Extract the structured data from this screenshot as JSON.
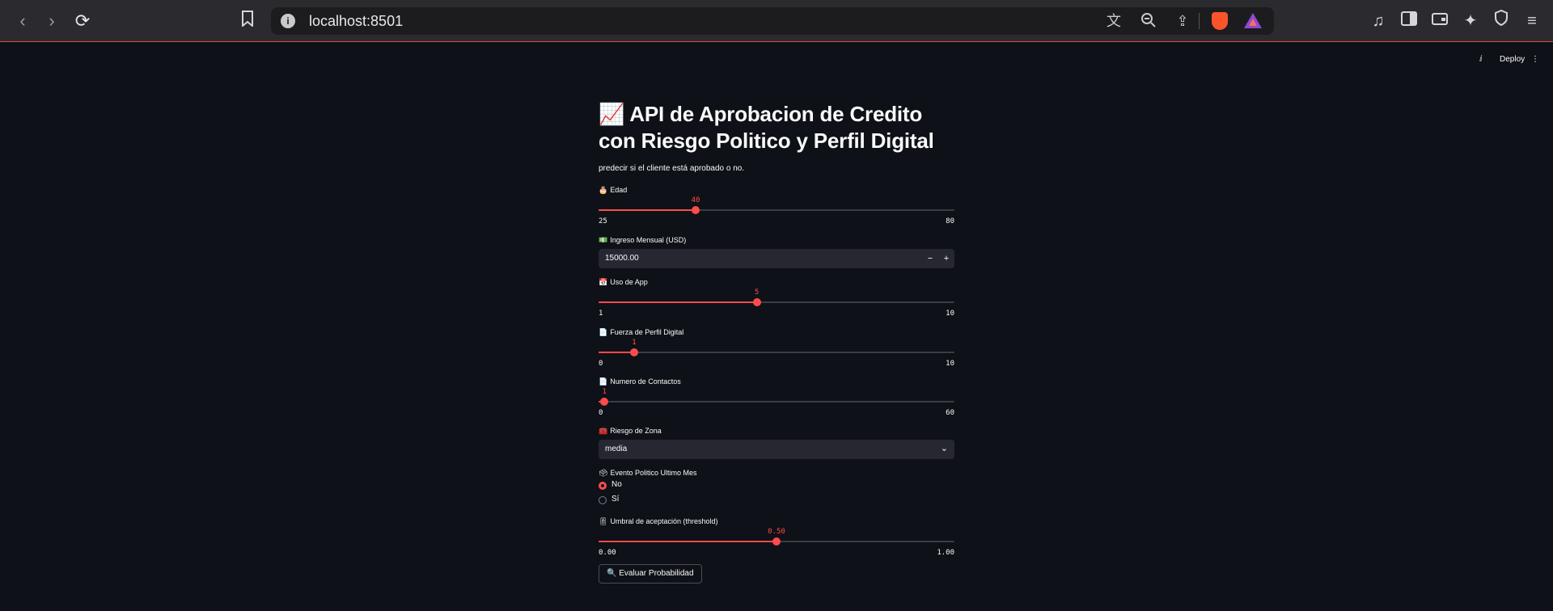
{
  "browser": {
    "url": "localhost:8501",
    "info_glyph": "i"
  },
  "header": {
    "deploy_label": "Deploy"
  },
  "page": {
    "title_emoji": "📈",
    "title": "API de Aprobacion de Credito con Riesgo Politico y Perfil Digital",
    "subtitle": "predecir si el cliente está aprobado o no."
  },
  "fields": {
    "edad": {
      "emoji": "🎂",
      "label": "Edad",
      "value": 40,
      "min": 25,
      "max": 80,
      "value_text": "40",
      "min_text": "25",
      "max_text": "80"
    },
    "ingreso": {
      "emoji": "💵",
      "label": "Ingreso Mensual (USD)",
      "value": "15000.00",
      "minus": "−",
      "plus": "+"
    },
    "uso_app": {
      "emoji": "📅",
      "label": "Uso de App",
      "value": 5,
      "min": 1,
      "max": 10,
      "value_text": "5",
      "min_text": "1",
      "max_text": "10"
    },
    "fuerza_perfil": {
      "emoji": "📄",
      "label": "Fuerza de Perfil Digital",
      "value": 1,
      "min": 0,
      "max": 10,
      "value_text": "1",
      "min_text": "0",
      "max_text": "10"
    },
    "contactos": {
      "emoji": "📄",
      "label": "Numero de Contactos",
      "value": 1,
      "min": 0,
      "max": 60,
      "value_text": "1",
      "min_text": "0",
      "max_text": "60"
    },
    "riesgo_zona": {
      "emoji": "🧰",
      "label": "Riesgo de Zona",
      "selected": "media"
    },
    "evento_politico": {
      "emoji": "🗳",
      "label": "Evento Politico Ultimo Mes",
      "options": [
        "No",
        "Sí"
      ],
      "selected_index": 0
    },
    "umbral": {
      "emoji": "🎚",
      "label": "Umbral de aceptación (threshold)",
      "value": 0.5,
      "min": 0,
      "max": 1,
      "value_text": "0.50",
      "min_text": "0.00",
      "max_text": "1.00"
    }
  },
  "actions": {
    "evaluate_icon": "🔍",
    "evaluate_label": "Evaluar Probabilidad"
  }
}
